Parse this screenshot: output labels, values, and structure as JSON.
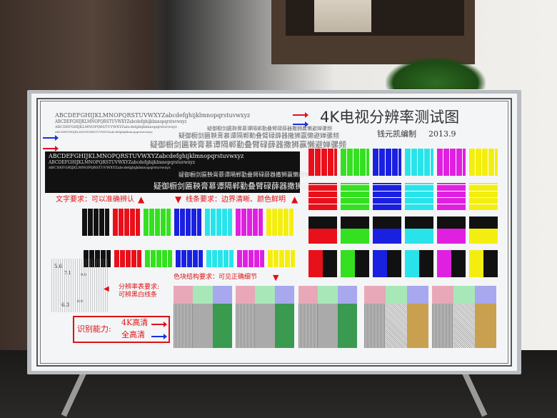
{
  "chart": {
    "title": "4K电视分辨率测试图",
    "author": "钱元凯编制",
    "date": "2013.9",
    "latin_line": "ABCDEFGHIJKLMNOPQRSTUVWXYZabcdefghijklmnopqrstuvwxyz",
    "cjk_line": "疑御橱剑匾鞅膏慕谭隔郸勤叠臂碌薛器撒狮赢懒避婵骡频",
    "text_req": "文字要求：可以准确辨认",
    "line_req": "线条要求：边界清晰、颜色鲜明",
    "block_req": "色块结构要求：可见正确细节",
    "res_req_1": "分辨率表要求:",
    "res_req_2": "可辨黑白线条",
    "ability_label": "识别能力:",
    "uhd_label": "4K高清",
    "fhd_label": "全高清",
    "res_numbers": [
      "5.6",
      "7.1",
      "9.0",
      "6.3",
      "8.0"
    ]
  },
  "colors": {
    "red": "#e8101a",
    "green": "#34e020",
    "blue": "#1a20e0",
    "cyan": "#28e4ea",
    "magenta": "#e020e0",
    "yellow": "#f4ee10",
    "black": "#111111",
    "uhd_arrow": "#e01020",
    "fhd_arrow": "#1830e0"
  }
}
